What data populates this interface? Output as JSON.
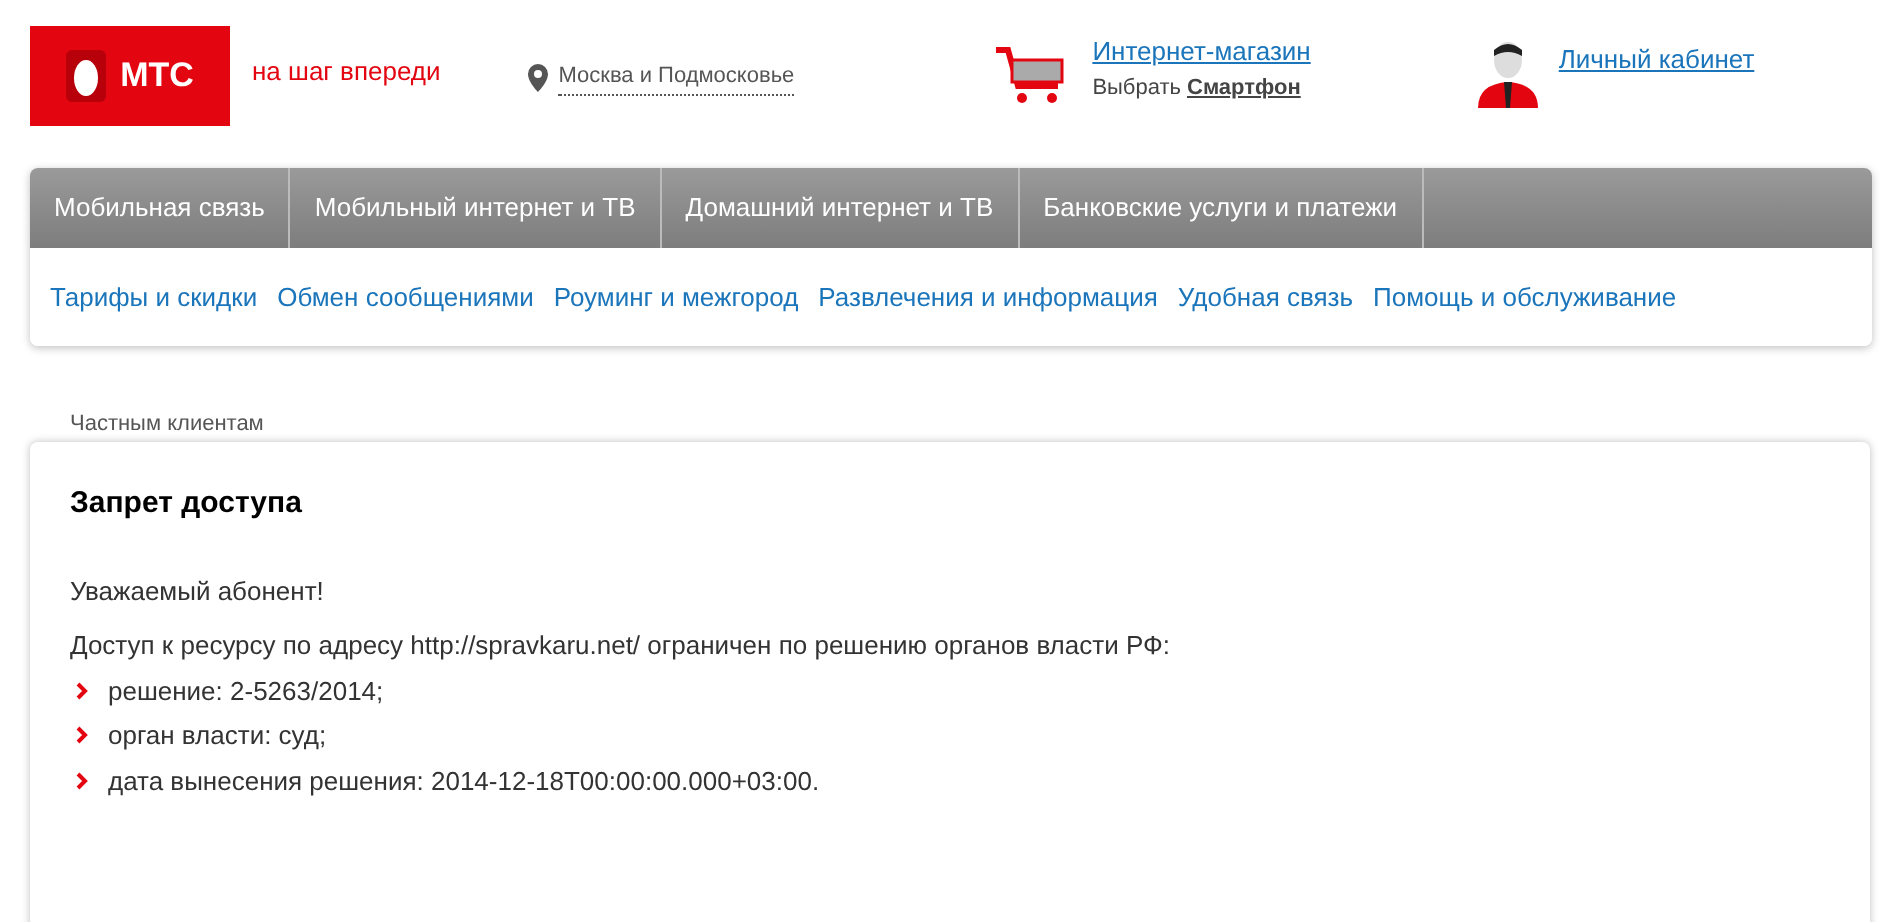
{
  "header": {
    "logo_text": "МТС",
    "tagline": "на шаг впереди",
    "region": "Москва и Подмосковье",
    "shop_link": "Интернет-магазин",
    "shop_prefix": "Выбрать",
    "shop_product": "Смартфон",
    "account_link": "Личный кабинет"
  },
  "nav": [
    "Мобильная связь",
    "Мобильный интернет и ТВ",
    "Домашний интернет и ТВ",
    "Банковские услуги и платежи"
  ],
  "subnav": [
    "Тарифы и скидки",
    "Обмен сообщениями",
    "Роуминг и межгород",
    "Развлечения и информация",
    "Удобная связь",
    "Помощь и обслуживание"
  ],
  "breadcrumb": "Частным клиентам",
  "content": {
    "title": "Запрет доступа",
    "greeting": "Уважаемый абонент!",
    "intro": "Доступ к ресурсу по адресу http://spravkaru.net/ ограничен по решению органов власти РФ:",
    "items": [
      "решение: 2-5263/2014;",
      "орган власти: суд;",
      "дата вынесения решения: 2014-12-18T00:00:00.000+03:00."
    ]
  }
}
